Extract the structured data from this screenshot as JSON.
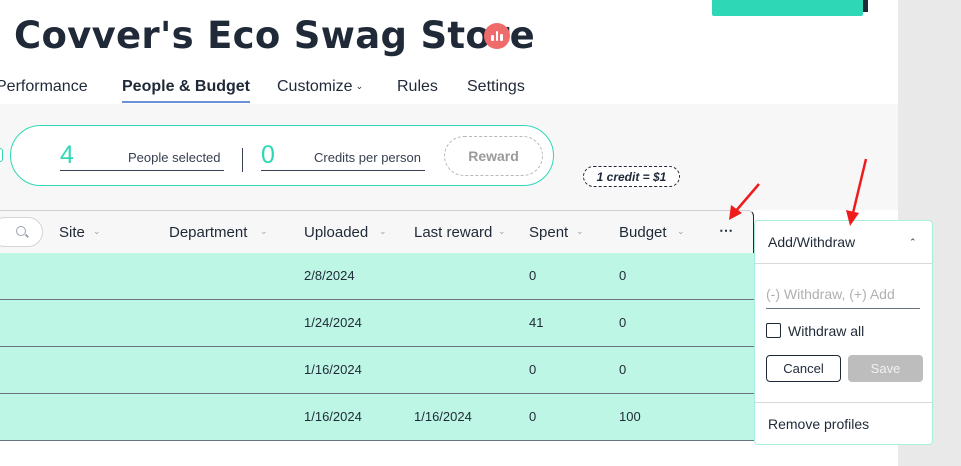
{
  "store": {
    "title": "Covver's Eco Swag Store",
    "badge_icon": "bar-chart-icon"
  },
  "tabs": [
    {
      "label": "Performance",
      "active": false
    },
    {
      "label": "People & Budget",
      "active": true
    },
    {
      "label": "Customize",
      "active": false,
      "has_dropdown": true
    },
    {
      "label": "Rules",
      "active": false
    },
    {
      "label": "Settings",
      "active": false
    }
  ],
  "reward_bar": {
    "people_count": "4",
    "people_label": "People selected",
    "credits_count": "0",
    "credits_label": "Credits per person",
    "reward_button": "Reward"
  },
  "credit_note": "1 credit = $1",
  "table": {
    "columns": [
      "Site",
      "Department",
      "Uploaded",
      "Last reward",
      "Spent",
      "Budget"
    ],
    "more_label": "⋯",
    "rows": [
      {
        "uploaded": "2/8/2024",
        "last_reward": "",
        "spent": "0",
        "budget": "0"
      },
      {
        "uploaded": "1/24/2024",
        "last_reward": "",
        "spent": "41",
        "budget": "0"
      },
      {
        "uploaded": "1/16/2024",
        "last_reward": "",
        "spent": "0",
        "budget": "0"
      },
      {
        "uploaded": "1/16/2024",
        "last_reward": "1/16/2024",
        "spent": "0",
        "budget": "100"
      }
    ]
  },
  "popover": {
    "title": "Add/Withdraw",
    "input_placeholder": "(-) Withdraw, (+) Add",
    "input_value": "",
    "checkbox_label": "Withdraw all",
    "checkbox_checked": false,
    "cancel_label": "Cancel",
    "save_label": "Save",
    "remove_label": "Remove profiles"
  },
  "colors": {
    "accent": "#2ed8b6",
    "row_highlight": "#bdf6e4",
    "badge": "#f06b6b",
    "annotation_arrow": "#ee1c1c",
    "tab_underline": "#6d8fd6"
  }
}
